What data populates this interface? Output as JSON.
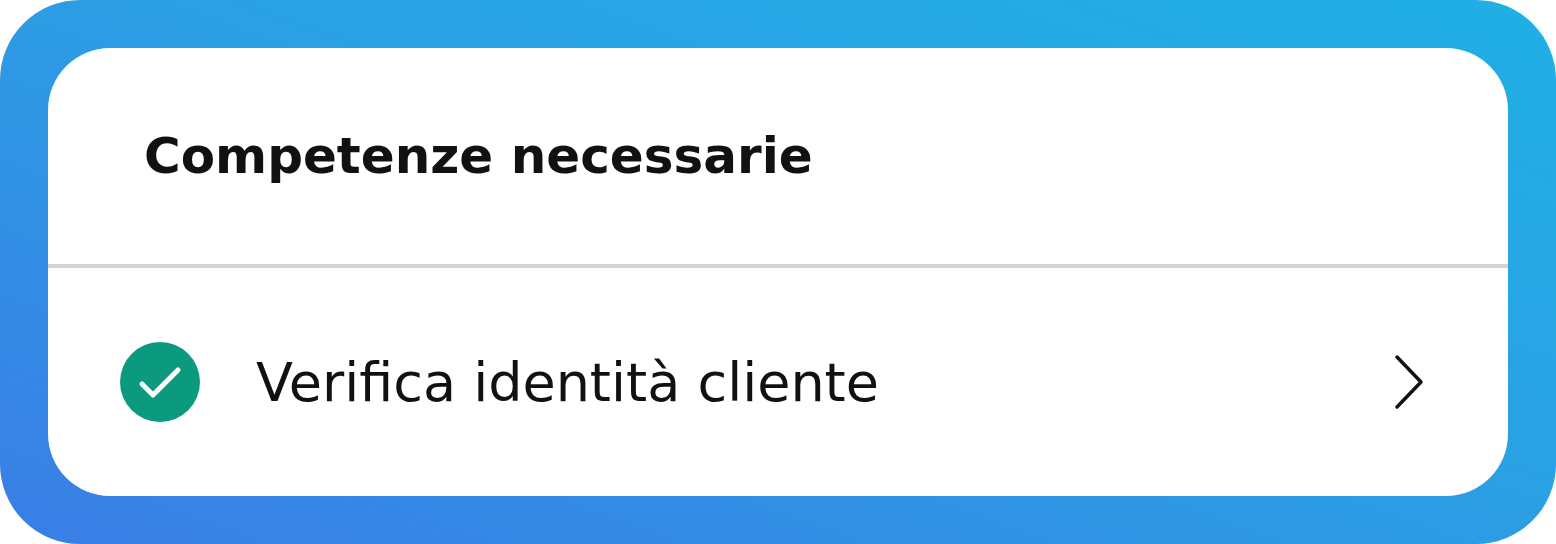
{
  "card": {
    "title": "Competenze necessarie",
    "items": [
      {
        "label": "Verifica identità cliente",
        "checked": true
      }
    ]
  }
}
